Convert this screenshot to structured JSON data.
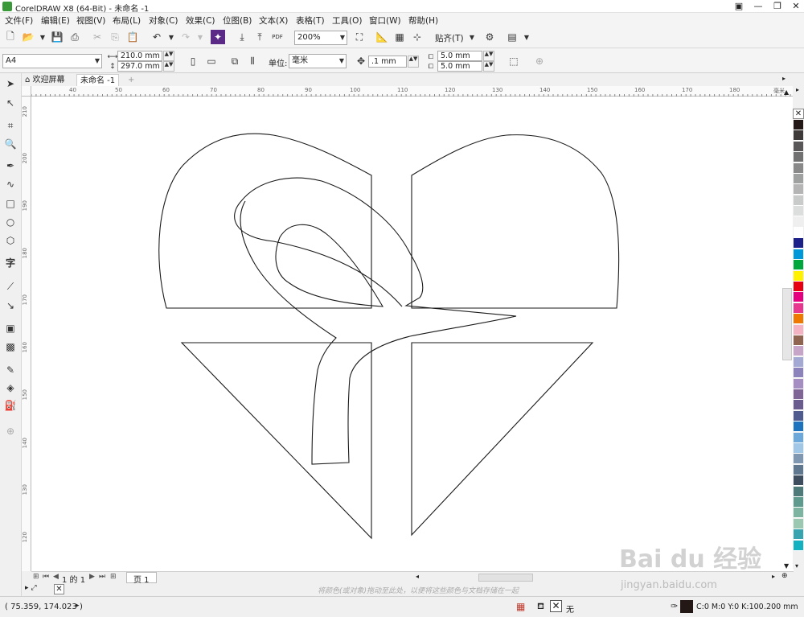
{
  "window": {
    "title": "CorelDRAW X8 (64-Bit) - 未命名 -1"
  },
  "menu": [
    "文件(F)",
    "编辑(E)",
    "视图(V)",
    "布局(L)",
    "对象(C)",
    "效果(C)",
    "位图(B)",
    "文本(X)",
    "表格(T)",
    "工具(O)",
    "窗口(W)",
    "帮助(H)"
  ],
  "toolbar": {
    "zoom": "200%",
    "snap_label": "贴齐(T)",
    "pdf_label": "PDF"
  },
  "property_bar": {
    "page_size": "A4",
    "width": "210.0 mm",
    "height": "297.0 mm",
    "units_label": "单位:",
    "units_value": "毫米",
    "nudge": ".1 mm",
    "dup_x": "5.0 mm",
    "dup_y": "5.0 mm"
  },
  "doc_tabs": [
    "欢迎屏幕",
    "未命名 -1"
  ],
  "rulers": {
    "h": [
      "40",
      "50",
      "60",
      "70",
      "80",
      "90",
      "100",
      "110",
      "120",
      "130",
      "140",
      "150",
      "160",
      "170",
      "180"
    ],
    "h_unit": "毫米",
    "v": [
      "210",
      "200",
      "190",
      "180",
      "170",
      "160",
      "150",
      "140",
      "130",
      "120"
    ]
  },
  "page_nav": {
    "counter": "1 的 1",
    "page_tab": "页 1"
  },
  "palette_hint": "将颜色(或对象)拖动至此处，以便将这些颜色与文档存储在一起",
  "status": {
    "coords": "( 75.359, 174.023 )",
    "fill_none": "无",
    "outline_cmyk": "C:0 M:0 Y:0 K:100",
    "outline_width": ".200 mm"
  },
  "palette_colors": [
    "#231815",
    "#3e3a39",
    "#595757",
    "#727171",
    "#898989",
    "#9fa0a0",
    "#b5b5b6",
    "#c9caca",
    "#dcdddd",
    "#efefef",
    "#ffffff",
    "#1d2088",
    "#0098d9",
    "#00a73c",
    "#fff100",
    "#e60012",
    "#e4007f",
    "#e8378f",
    "#ee7800",
    "#f4b3c2",
    "#8f6552",
    "#c7a5c9",
    "#a3a9d2",
    "#8c82bc",
    "#a48ec2",
    "#7f6696",
    "#6b5c8f",
    "#4f5a8f",
    "#1e73be",
    "#6ca8d9",
    "#a1c7e6",
    "#7f97b0",
    "#60788f",
    "#3e4e5e",
    "#4e7a7a",
    "#5f9a8e",
    "#7cb3a1",
    "#9bc8b0",
    "#37a4b0",
    "#14b1c0"
  ],
  "watermark": {
    "brand": "Bai du 经验",
    "url": "jingyan.baidu.com"
  }
}
